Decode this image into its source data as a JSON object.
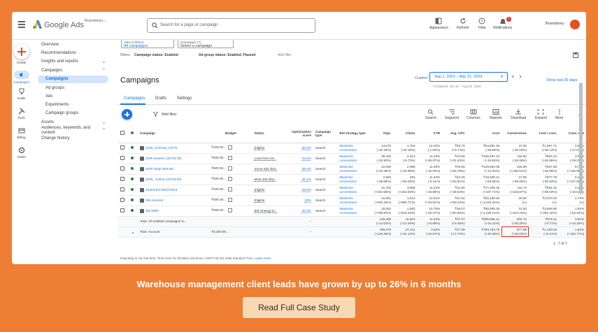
{
  "topbar": {
    "app_name": "Google Ads",
    "account": "Brandstory",
    "search_placeholder": "Search for a page or campaign",
    "tools": [
      {
        "label": "Appearance",
        "icon": "appearance-icon"
      },
      {
        "label": "Refresh",
        "icon": "refresh-icon"
      },
      {
        "label": "Help",
        "icon": "help-icon"
      },
      {
        "label": "Notifications",
        "icon": "bell-icon",
        "badge": "1"
      }
    ],
    "user": "Brandstory"
  },
  "rail": [
    {
      "label": "Create",
      "icon": "plus-icon"
    },
    {
      "label": "Campaigns",
      "icon": "megaphone-icon"
    },
    {
      "label": "Goals",
      "icon": "trophy-icon"
    },
    {
      "label": "Tools",
      "icon": "tools-icon"
    },
    {
      "label": "Billing",
      "icon": "billing-icon"
    },
    {
      "label": "Admin",
      "icon": "admin-icon"
    }
  ],
  "nav": {
    "overview": "Overview",
    "recommendations": "Recommendations",
    "insights": "Insights and reports",
    "campaigns_group": "Campaigns",
    "campaigns": "Campaigns",
    "ad_groups": "Ad groups",
    "ads": "Ads",
    "experiments": "Experiments",
    "campaign_groups": "Campaign groups",
    "assets": "Assets",
    "audiences": "Audiences, keywords, and content",
    "change_history": "Change history"
  },
  "filters": {
    "view_label": "View (2 filters)",
    "view_value": "All campaigns",
    "campaigns_label": "Campaigns (7)",
    "campaigns_value": "Select a campaign",
    "filters_label": "Filters",
    "filter1": "Campaign status: Enabled",
    "filter2": "Ad group status: Enabled, Paused",
    "add_filter": "Add filter"
  },
  "page": {
    "title": "Campaigns",
    "custom": "Custom",
    "date_range": "Sep 1, 2023 – Mar 31, 2024",
    "compared": "Compared: Jan 31 – Aug 31, 2023",
    "show_last": "Show last 30 days"
  },
  "tabs": [
    "Campaigns",
    "Drafts",
    "Settings"
  ],
  "toolbar": {
    "add_filter": "Add filter",
    "items": [
      "Search",
      "Segment",
      "Columns",
      "Reports",
      "Download",
      "Expand",
      "More"
    ]
  },
  "table": {
    "headers": [
      "Campaign",
      "Budget",
      "Status",
      "Optimization score",
      "Campaign type",
      "Bid strategy type",
      "Impr.",
      "Clicks",
      "CTR",
      "Avg. CPC",
      "Cost",
      "Conversions",
      "Cost / conv.",
      "Conv. rate"
    ],
    "rows": [
      {
        "name": "ESR_Chennai_13/7/2",
        "budget": "₹400.00...",
        "status": "Eligible",
        "opt": "50.6%",
        "type": "Search",
        "bid": "Maximize conversions",
        "impr": [
          "14,670",
          "(-32.40%)"
        ],
        "clicks": [
          "1,764",
          "(-33.18%)"
        ],
        "ctr": [
          "12.02%",
          "(-1.03%)"
        ],
        "cpc": [
          "₹53.79",
          "(+6.74%)"
        ],
        "cost": [
          "₹94,891.45",
          "(-28.68%)"
        ],
        "conv": [
          "47.50",
          "(-45.19%)"
        ],
        "cpconv": [
          "₹1,997.71",
          "(+30.14%)"
        ],
        "rate": [
          "2.69%",
          "(-17.97%)"
        ]
      },
      {
        "name": "ESR Generic 13/7/22 BS",
        "budget": "₹500.00...",
        "status": "Lead form ext...",
        "opt": "43.6%",
        "type": "Search",
        "bid": "Maximize conversions",
        "impr": [
          "38,403",
          "(-32.90%)"
        ],
        "clicks": [
          "4,313",
          "(-8.72%)"
        ],
        "ctr": [
          "11.23%",
          "(+36.57%)"
        ],
        "cpc": [
          "₹24.65",
          "(+31.63%)"
        ],
        "cost": [
          "₹106,297.22",
          "(+16.82%)"
        ],
        "conv": [
          "132.50",
          "(-36.09%)"
        ],
        "cpconv": [
          "₹802.24",
          "(+82.65%)"
        ],
        "rate": [
          "3.07%",
          "(-29.20%)"
        ]
      },
      {
        "name": "ESR Tanje 25/8 BS",
        "budget": "₹500.00...",
        "status": "Some ads disa...",
        "opt": "58.4%",
        "type": "Search",
        "bid": "Maximize conversions",
        "impr": [
          "22,945",
          "(+34.48%)"
        ],
        "clicks": [
          "2,588",
          "(+20.99%)"
        ],
        "ctr": [
          "11.28%",
          "(-10.03%)"
        ],
        "cpc": [
          "₹49.58",
          "(+56.78%)"
        ],
        "cost": [
          "₹128,854.08",
          "(+14.02%)"
        ],
        "conv": [
          "226.98",
          "(+185.51%)"
        ],
        "cpconv": [
          "₹567.69",
          "(-60.06%)"
        ],
        "rate": [
          "8.77%",
          "(+135.98%)"
        ]
      },
      {
        "name": "ESR_ Sohna 13/7/22 BS",
        "budget": "₹500.00...",
        "status": "Most ads disa...",
        "opt": "46.1%",
        "type": "Search",
        "bid": "Maximize conversions",
        "impr": [
          "2,592",
          "(-39.89%)"
        ],
        "clicks": [
          "294",
          "(-90.20%)"
        ],
        "ctr": [
          "11.34%",
          "(-0.11%)"
        ],
        "cpc": [
          "₹62.25",
          "(+64.81%)"
        ],
        "cost": [
          "₹18,300.21",
          "(-83.85%)"
        ],
        "conv": [
          "27.00",
          "(-59.09%)"
        ],
        "cpconv": [
          "₹677.79",
          "(-60.53%)"
        ],
        "rate": [
          "9.18%",
          "(+317.58%)"
        ]
      },
      {
        "name": "Brand-BS-05/07/2023",
        "budget": "₹400.00...",
        "status": "Eligible",
        "opt": "29.9%",
        "type": "Search",
        "bid": "Maximize conversions",
        "impr": [
          "31,752",
          "(+344.55%)"
        ],
        "clicks": [
          "3,566",
          "(+252.03%)"
        ],
        "ctr": [
          "11.24%",
          "(-18.55%)"
        ],
        "cpc": [
          "₹21.66",
          "(+48.53%)"
        ],
        "cost": [
          "₹77,256.18",
          "(+437.71%)"
        ],
        "conv": [
          "111.74",
          "(+223.87%)"
        ],
        "cpconv": [
          "₹691.42",
          "(+66.03%)"
        ],
        "rate": [
          "3.13%",
          "(-10.54%)"
        ]
      },
      {
        "name": "BS-General",
        "budget": "₹500.00...",
        "status": "Eligible",
        "opt": "32%",
        "type": "Search",
        "bid": "Maximize conversions",
        "impr": [
          "12,561",
          "(+632.34%)"
        ],
        "clicks": [
          "1,614",
          "(+880.71%)"
        ],
        "ctr": [
          "12.91%",
          "(+33.91%)"
        ],
        "cpc": [
          "₹51.52",
          "(+68.24%)"
        ],
        "cost": [
          "₹83,160.92",
          "(+1,516.31%)"
        ],
        "conv": [
          "28.00",
          "(∞)"
        ],
        "cpconv": [
          "₹2,970.03",
          "(∞)"
        ],
        "rate": [
          "1.73%",
          "(∞)"
        ]
      },
      {
        "name": "BS-Delhi",
        "budget": "₹500.00...",
        "status": "Bid strategy le...",
        "opt": "40.9%",
        "type": "Search",
        "bid": "Maximize conversions",
        "impr": [
          "15,652",
          "(+789.82%)"
        ],
        "clicks": [
          "1,683",
          "(+623.43%)"
        ],
        "ctr": [
          "10.75%",
          "(-18.47%)"
        ],
        "cpc": [
          "₹48.07",
          "(+83.65%)"
        ],
        "cost": [
          "₹80,905.35",
          "(+1,248.21%)"
        ],
        "conv": [
          "31.00",
          "(+244.44%)"
        ],
        "cpconv": [
          "₹2,609.85",
          "(+291.42%)"
        ],
        "rate": [
          "1.84%",
          "(-52.52%)"
        ]
      }
    ],
    "total_enabled": {
      "label": "Total: All enabled campaigns in...",
      "opt": "–",
      "impr": [
        "138,485",
        "(+14.03%)"
      ],
      "clicks": [
        "15,822",
        "(+13.48%)"
      ],
      "ctr": [
        "11.42%",
        "(+0.88%)"
      ],
      "cpc": [
        "₹37.27",
        "(+9.35%)"
      ],
      "cost": [
        "₹589,665.41",
        "(+24.31%)"
      ],
      "conv": [
        "604.72",
        "(+25.20%)"
      ],
      "cpconv": [
        "₹975.11",
        "(-0.71%)"
      ],
      "rate": [
        "3.82%",
        "(+10.33%)"
      ]
    },
    "total_account": {
      "label": "Total: Account",
      "budget": "₹3,300.00...",
      "opt": "–",
      "impr": [
        "785,076",
        "(+146.25%)"
      ],
      "clicks": [
        "27,441",
        "(+61.13%)"
      ],
      "ctr": [
        "3.50%",
        "(-34.57%)"
      ],
      "cpc": [
        "₹27.69",
        "(-17.72%)"
      ],
      "cost": [
        "₹759,783.79",
        "(+32.58%)"
      ],
      "conv": [
        "677.99",
        "(+26.02%)"
      ],
      "cpconv": [
        "₹1,120.63",
        "(+5.21%)"
      ],
      "rate": [
        "1.93%",
        "(+153.77%)"
      ]
    }
  },
  "pager": "1 - 7 of 7",
  "footer_note": {
    "text": "Reporting is not real-time. Time zone for all dates and times: (GMT+05:30) India Standard Time.",
    "link": "Learn more"
  },
  "promo": {
    "headline": "Warehouse management client leads have grown by up to 26% in 6 months",
    "cta": "Read Full Case Study"
  },
  "colors": {
    "background": "#ee7e33",
    "accent": "#1a73e8",
    "highlight": "#d93025",
    "cta_bg": "#f8d9b4"
  }
}
